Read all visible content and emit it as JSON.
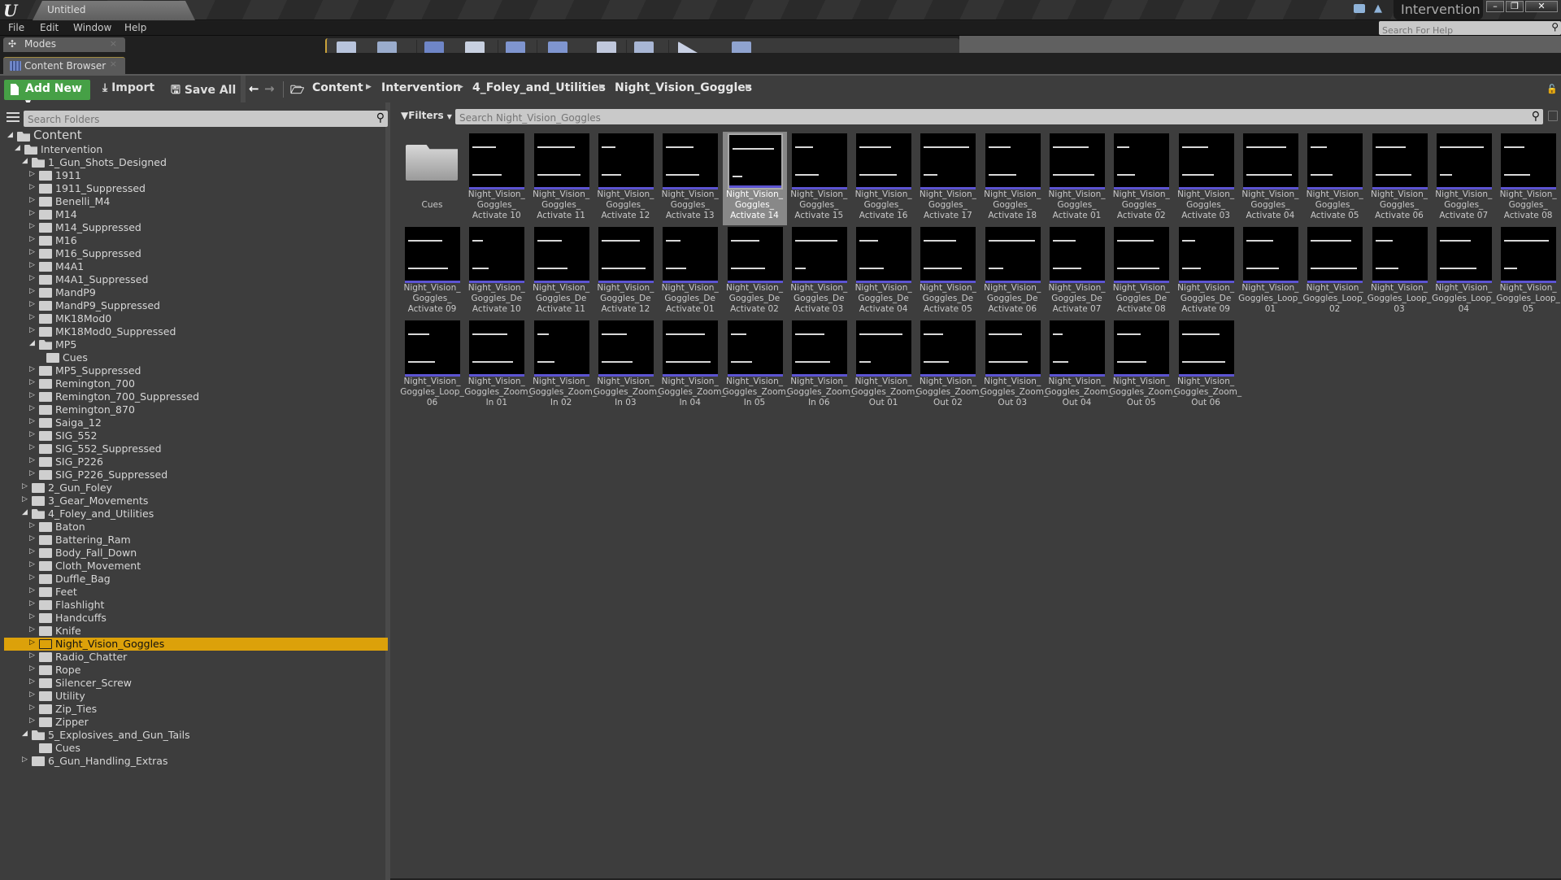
{
  "window": {
    "document_tab": "Untitled",
    "project_name": "Intervention",
    "controls": [
      "minimize",
      "restore",
      "close"
    ]
  },
  "menu": [
    "File",
    "Edit",
    "Window",
    "Help"
  ],
  "help_search": {
    "placeholder": "Search For Help"
  },
  "panels": {
    "modes_tab": "Modes",
    "content_browser_tab": "Content Browser"
  },
  "toolbar": {
    "add_new": "Add New",
    "import": "Import",
    "save_all": "Save All"
  },
  "breadcrumb": [
    "Content",
    "Intervention",
    "4_Foley_and_Utilities",
    "Night_Vision_Goggles"
  ],
  "folder_search": {
    "placeholder": "Search Folders"
  },
  "tree": [
    {
      "label": "Content",
      "depth": 0,
      "state": "open",
      "root": true
    },
    {
      "label": "Intervention",
      "depth": 1,
      "state": "open"
    },
    {
      "label": "1_Gun_Shots_Designed",
      "depth": 2,
      "state": "open"
    },
    {
      "label": "1911",
      "depth": 3,
      "state": "closed"
    },
    {
      "label": "1911_Suppressed",
      "depth": 3,
      "state": "closed"
    },
    {
      "label": "Benelli_M4",
      "depth": 3,
      "state": "closed"
    },
    {
      "label": "M14",
      "depth": 3,
      "state": "closed"
    },
    {
      "label": "M14_Suppressed",
      "depth": 3,
      "state": "closed"
    },
    {
      "label": "M16",
      "depth": 3,
      "state": "closed"
    },
    {
      "label": "M16_Suppressed",
      "depth": 3,
      "state": "closed"
    },
    {
      "label": "M4A1",
      "depth": 3,
      "state": "closed"
    },
    {
      "label": "M4A1_Suppressed",
      "depth": 3,
      "state": "closed"
    },
    {
      "label": "MandP9",
      "depth": 3,
      "state": "closed"
    },
    {
      "label": "MandP9_Suppressed",
      "depth": 3,
      "state": "closed"
    },
    {
      "label": "MK18Mod0",
      "depth": 3,
      "state": "closed"
    },
    {
      "label": "MK18Mod0_Suppressed",
      "depth": 3,
      "state": "closed"
    },
    {
      "label": "MP5",
      "depth": 3,
      "state": "open"
    },
    {
      "label": "Cues",
      "depth": 4,
      "state": "leaf"
    },
    {
      "label": "MP5_Suppressed",
      "depth": 3,
      "state": "closed"
    },
    {
      "label": "Remington_700",
      "depth": 3,
      "state": "closed"
    },
    {
      "label": "Remington_700_Suppressed",
      "depth": 3,
      "state": "closed"
    },
    {
      "label": "Remington_870",
      "depth": 3,
      "state": "closed"
    },
    {
      "label": "Saiga_12",
      "depth": 3,
      "state": "closed"
    },
    {
      "label": "SIG_552",
      "depth": 3,
      "state": "closed"
    },
    {
      "label": "SIG_552_Suppressed",
      "depth": 3,
      "state": "closed"
    },
    {
      "label": "SIG_P226",
      "depth": 3,
      "state": "closed"
    },
    {
      "label": "SIG_P226_Suppressed",
      "depth": 3,
      "state": "closed"
    },
    {
      "label": "2_Gun_Foley",
      "depth": 2,
      "state": "closed"
    },
    {
      "label": "3_Gear_Movements",
      "depth": 2,
      "state": "closed"
    },
    {
      "label": "4_Foley_and_Utilities",
      "depth": 2,
      "state": "open"
    },
    {
      "label": "Baton",
      "depth": 3,
      "state": "closed"
    },
    {
      "label": "Battering_Ram",
      "depth": 3,
      "state": "closed"
    },
    {
      "label": "Body_Fall_Down",
      "depth": 3,
      "state": "closed"
    },
    {
      "label": "Cloth_Movement",
      "depth": 3,
      "state": "closed"
    },
    {
      "label": "Duffle_Bag",
      "depth": 3,
      "state": "closed"
    },
    {
      "label": "Feet",
      "depth": 3,
      "state": "closed"
    },
    {
      "label": "Flashlight",
      "depth": 3,
      "state": "closed"
    },
    {
      "label": "Handcuffs",
      "depth": 3,
      "state": "closed"
    },
    {
      "label": "Knife",
      "depth": 3,
      "state": "closed"
    },
    {
      "label": "Night_Vision_Goggles",
      "depth": 3,
      "state": "closed",
      "selected": true
    },
    {
      "label": "Radio_Chatter",
      "depth": 3,
      "state": "closed"
    },
    {
      "label": "Rope",
      "depth": 3,
      "state": "closed"
    },
    {
      "label": "Silencer_Screw",
      "depth": 3,
      "state": "closed"
    },
    {
      "label": "Utility",
      "depth": 3,
      "state": "closed"
    },
    {
      "label": "Zip_Ties",
      "depth": 3,
      "state": "closed"
    },
    {
      "label": "Zipper",
      "depth": 3,
      "state": "closed"
    },
    {
      "label": "5_Explosives_and_Gun_Tails",
      "depth": 2,
      "state": "open"
    },
    {
      "label": "Cues",
      "depth": 3,
      "state": "leaf"
    },
    {
      "label": "6_Gun_Handling_Extras",
      "depth": 2,
      "state": "closed"
    }
  ],
  "asset_filters": {
    "label": "Filters",
    "search_placeholder": "Search Night_Vision_Goggles"
  },
  "colors": {
    "selection": "#dca10a",
    "sound_wave_bar": "#5c54d2",
    "add_new_green": "#46a046"
  },
  "assets": [
    {
      "type": "folder",
      "name": "Cues"
    },
    {
      "type": "sound",
      "name": "Night_Vision_\nGoggles_\nActivate 10"
    },
    {
      "type": "sound",
      "name": "Night_Vision_\nGoggles_\nActivate 11"
    },
    {
      "type": "sound",
      "name": "Night_Vision_\nGoggles_\nActivate 12"
    },
    {
      "type": "sound",
      "name": "Night_Vision_\nGoggles_\nActivate 13"
    },
    {
      "type": "sound",
      "name": "Night_Vision_\nGoggles_\nActivate 14",
      "selected": true
    },
    {
      "type": "sound",
      "name": "Night_Vision_\nGoggles_\nActivate 15"
    },
    {
      "type": "sound",
      "name": "Night_Vision_\nGoggles_\nActivate 16"
    },
    {
      "type": "sound",
      "name": "Night_Vision_\nGoggles_\nActivate 17"
    },
    {
      "type": "sound",
      "name": "Night_Vision_\nGoggles_\nActivate 18"
    },
    {
      "type": "sound",
      "name": "Night_Vision_\nGoggles_\nActivate 01"
    },
    {
      "type": "sound",
      "name": "Night_Vision_\nGoggles_\nActivate 02"
    },
    {
      "type": "sound",
      "name": "Night_Vision_\nGoggles_\nActivate 03"
    },
    {
      "type": "sound",
      "name": "Night_Vision_\nGoggles_\nActivate 04"
    },
    {
      "type": "sound",
      "name": "Night_Vision_\nGoggles_\nActivate 05"
    },
    {
      "type": "sound",
      "name": "Night_Vision_\nGoggles_\nActivate 06"
    },
    {
      "type": "sound",
      "name": "Night_Vision_\nGoggles_\nActivate 07"
    },
    {
      "type": "sound",
      "name": "Night_Vision_\nGoggles_\nActivate 08"
    },
    {
      "type": "sound",
      "name": "Night_Vision_\nGoggles_\nActivate 09"
    },
    {
      "type": "sound",
      "name": "Night_Vision_\nGoggles_De\nActivate 10"
    },
    {
      "type": "sound",
      "name": "Night_Vision_\nGoggles_De\nActivate 11"
    },
    {
      "type": "sound",
      "name": "Night_Vision_\nGoggles_De\nActivate 12"
    },
    {
      "type": "sound",
      "name": "Night_Vision_\nGoggles_De\nActivate 01"
    },
    {
      "type": "sound",
      "name": "Night_Vision_\nGoggles_De\nActivate 02"
    },
    {
      "type": "sound",
      "name": "Night_Vision_\nGoggles_De\nActivate 03"
    },
    {
      "type": "sound",
      "name": "Night_Vision_\nGoggles_De\nActivate 04"
    },
    {
      "type": "sound",
      "name": "Night_Vision_\nGoggles_De\nActivate 05"
    },
    {
      "type": "sound",
      "name": "Night_Vision_\nGoggles_De\nActivate 06"
    },
    {
      "type": "sound",
      "name": "Night_Vision_\nGoggles_De\nActivate 07"
    },
    {
      "type": "sound",
      "name": "Night_Vision_\nGoggles_De\nActivate 08"
    },
    {
      "type": "sound",
      "name": "Night_Vision_\nGoggles_De\nActivate 09"
    },
    {
      "type": "sound",
      "name": "Night_Vision_\nGoggles_Loop_\n01"
    },
    {
      "type": "sound",
      "name": "Night_Vision_\nGoggles_Loop_\n02"
    },
    {
      "type": "sound",
      "name": "Night_Vision_\nGoggles_Loop_\n03"
    },
    {
      "type": "sound",
      "name": "Night_Vision_\nGoggles_Loop_\n04"
    },
    {
      "type": "sound",
      "name": "Night_Vision_\nGoggles_Loop_\n05"
    },
    {
      "type": "sound",
      "name": "Night_Vision_\nGoggles_Loop_\n06"
    },
    {
      "type": "sound",
      "name": "Night_Vision_\nGoggles_Zoom_\nIn 01"
    },
    {
      "type": "sound",
      "name": "Night_Vision_\nGoggles_Zoom_\nIn 02"
    },
    {
      "type": "sound",
      "name": "Night_Vision_\nGoggles_Zoom_\nIn 03"
    },
    {
      "type": "sound",
      "name": "Night_Vision_\nGoggles_Zoom_\nIn 04"
    },
    {
      "type": "sound",
      "name": "Night_Vision_\nGoggles_Zoom_\nIn 05"
    },
    {
      "type": "sound",
      "name": "Night_Vision_\nGoggles_Zoom_\nIn 06"
    },
    {
      "type": "sound",
      "name": "Night_Vision_\nGoggles_Zoom_\nOut 01"
    },
    {
      "type": "sound",
      "name": "Night_Vision_\nGoggles_Zoom_\nOut 02"
    },
    {
      "type": "sound",
      "name": "Night_Vision_\nGoggles_Zoom_\nOut 03"
    },
    {
      "type": "sound",
      "name": "Night_Vision_\nGoggles_Zoom_\nOut 04"
    },
    {
      "type": "sound",
      "name": "Night_Vision_\nGoggles_Zoom_\nOut 05"
    },
    {
      "type": "sound",
      "name": "Night_Vision_\nGoggles_Zoom_\nOut 06"
    }
  ]
}
